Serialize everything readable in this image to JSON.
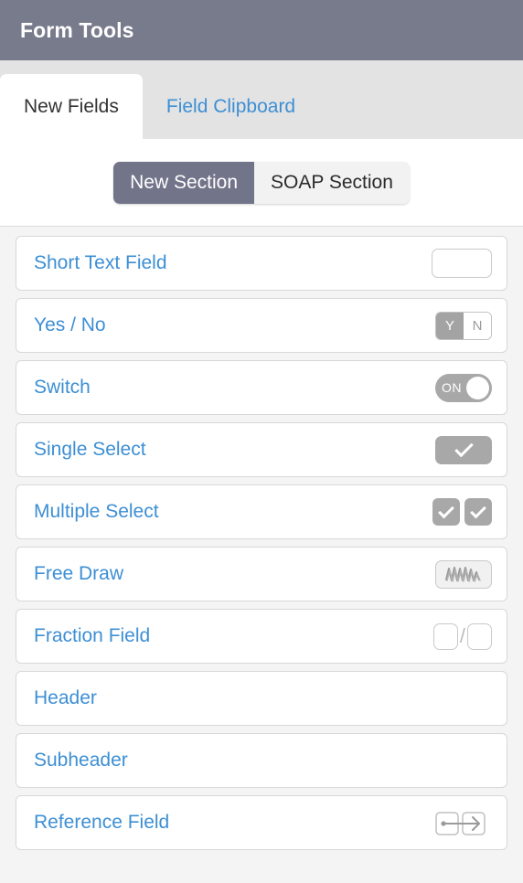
{
  "window": {
    "title": "Form Tools",
    "title_bar_color": "#787b8c"
  },
  "tabs": {
    "items": [
      {
        "label": "New Fields",
        "active": true
      },
      {
        "label": "Field Clipboard",
        "active": false
      }
    ],
    "link_color": "#3d8fd4",
    "active_text_color": "#333333"
  },
  "section_toggle": {
    "options": [
      {
        "label": "New Section",
        "active": true
      },
      {
        "label": "SOAP Section",
        "active": false
      }
    ],
    "active_color": "#72748a"
  },
  "field_list": {
    "items": [
      {
        "label": "Short Text Field",
        "icon": "text-box-icon"
      },
      {
        "label": "Yes / No",
        "icon": "yes-no-toggle-icon",
        "yes": "Y",
        "no": "N"
      },
      {
        "label": "Switch",
        "icon": "switch-on-icon",
        "state": "ON"
      },
      {
        "label": "Single Select",
        "icon": "single-checkmark-icon"
      },
      {
        "label": "Multiple Select",
        "icon": "multi-checkmark-icon"
      },
      {
        "label": "Free Draw",
        "icon": "scribble-icon"
      },
      {
        "label": "Fraction Field",
        "icon": "fraction-boxes-icon",
        "separator": "/"
      },
      {
        "label": "Header",
        "icon": "none"
      },
      {
        "label": "Subheader",
        "icon": "none"
      },
      {
        "label": "Reference Field",
        "icon": "reference-arrow-icon"
      }
    ],
    "label_color": "#3d8fd4"
  }
}
